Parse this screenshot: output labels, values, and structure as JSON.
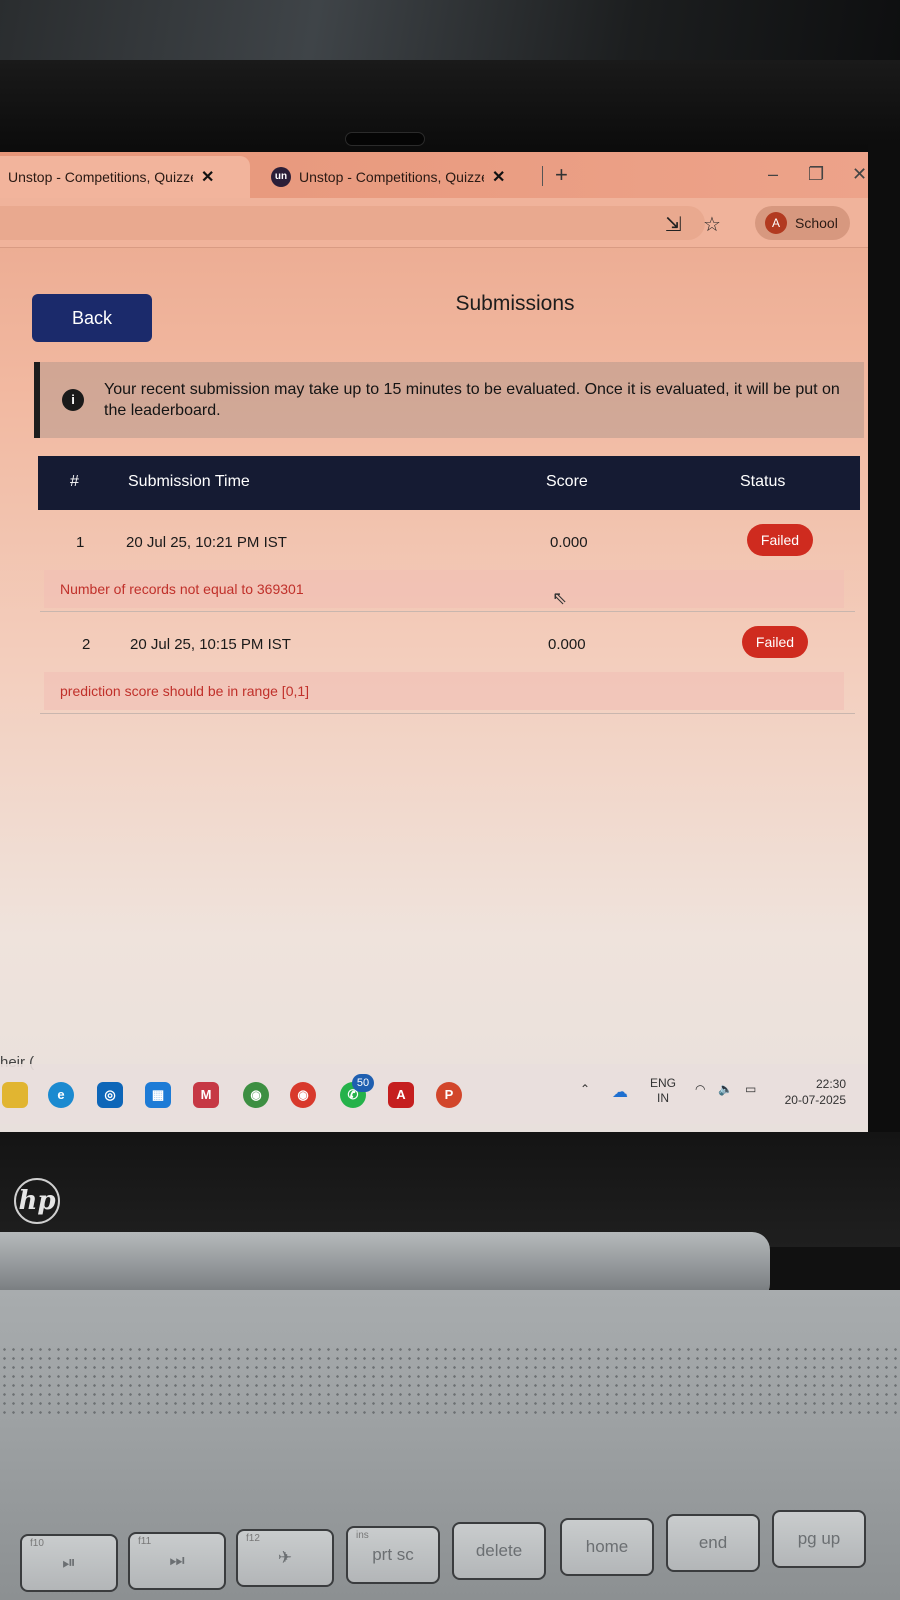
{
  "browser": {
    "tabs": [
      {
        "title": "Unstop - Competitions, Quizzes",
        "active": true
      },
      {
        "title": "Unstop - Competitions, Quizzes",
        "active": false,
        "favicon_text": "un"
      }
    ],
    "profile_initial": "A",
    "profile_name": "School"
  },
  "page": {
    "back_label": "Back",
    "title": "Submissions",
    "notice": "Your recent submission may take up to 15 minutes to be evaluated. Once it is evaluated, it will be put on the leaderboard."
  },
  "table": {
    "headers": {
      "index": "#",
      "time": "Submission Time",
      "score": "Score",
      "status": "Status"
    },
    "rows": [
      {
        "index": "1",
        "time": "20 Jul 25, 10:21 PM IST",
        "score": "0.000",
        "status": "Failed",
        "error": "Number of records not equal to 369301"
      },
      {
        "index": "2",
        "time": "20 Jul 25, 10:15 PM IST",
        "score": "0.000",
        "status": "Failed",
        "error": "prediction score should be in range [0,1]"
      }
    ]
  },
  "side_text": "heir (",
  "taskbar": {
    "whatsapp_badge": "50",
    "lang_line1": "ENG",
    "lang_line2": "IN",
    "time": "22:30",
    "date": "20-07-2025"
  },
  "keyboard": [
    {
      "label": "⏯",
      "fn": "f10"
    },
    {
      "label": "⏭",
      "fn": "f11"
    },
    {
      "label": "✈",
      "fn": "f12"
    },
    {
      "label": "prt sc",
      "fn": "ins"
    },
    {
      "label": "delete",
      "fn": ""
    },
    {
      "label": "home",
      "fn": ""
    },
    {
      "label": "end",
      "fn": ""
    },
    {
      "label": "pg up",
      "fn": ""
    }
  ],
  "logo": "hp",
  "colors": {
    "back_button": "#1b2a6b",
    "table_header": "#151b33",
    "failed_badge": "#cf2b1f",
    "error_text": "#c0302a"
  }
}
